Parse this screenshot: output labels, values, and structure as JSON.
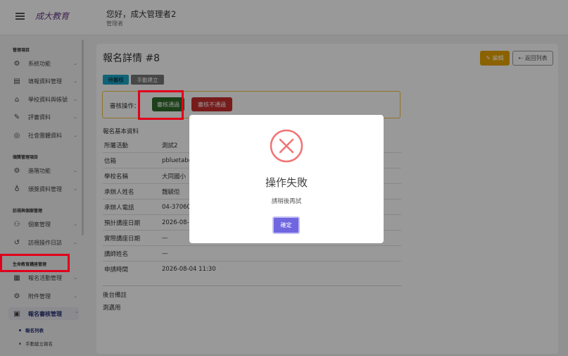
{
  "header": {
    "logo_text": "成大教育",
    "greeting": "您好，成大管理者2",
    "role": "管理者"
  },
  "sidebar": {
    "sections": [
      {
        "title": "管理項目",
        "items": [
          {
            "label": "系統功能",
            "icon": "gear-icon"
          },
          {
            "label": "填報資料管理",
            "icon": "form-icon"
          },
          {
            "label": "學校資料與帳號",
            "icon": "school-icon"
          },
          {
            "label": "評審資料",
            "icon": "review-icon"
          },
          {
            "label": "社會團體資料",
            "icon": "compass-icon"
          }
        ]
      },
      {
        "title": "頒獎管理項目",
        "items": [
          {
            "label": "進階功能",
            "icon": "gear-icon"
          },
          {
            "label": "頒獎資料管理",
            "icon": "medal-icon"
          }
        ]
      },
      {
        "title": "訪視與個案管理",
        "items": [
          {
            "label": "個案管理",
            "icon": "users-icon"
          },
          {
            "label": "訪視操作日誌",
            "icon": "history-icon"
          }
        ]
      },
      {
        "title": "生命教育講座管理",
        "items": [
          {
            "label": "報名活動管理",
            "icon": "calendar-icon"
          },
          {
            "label": "附件管理",
            "icon": "gear-icon"
          },
          {
            "label": "報名審核管理",
            "icon": "clipboard-icon"
          }
        ]
      }
    ],
    "sub_items": [
      "報名列表",
      "手動建立報名"
    ]
  },
  "main": {
    "title": "報名詳情 #8",
    "edit_label": "編輯",
    "back_label": "返回列表",
    "status_badge": "待審核",
    "source_badge": "手動建立",
    "review_label": "審核操作：",
    "approve_label": "審核通過",
    "reject_label": "審核不通過",
    "info_title": "報名基本資料",
    "info_rows": [
      {
        "k": "所屬活動",
        "v": "測試2"
      },
      {
        "k": "信箱",
        "v": "pbluetabo"
      },
      {
        "k": "學校名稱",
        "v": "大同國小"
      },
      {
        "k": "承辦人姓名",
        "v": "魏毓佢"
      },
      {
        "k": "承辦人電話",
        "v": "04-37060"
      },
      {
        "k": "預計講座日期",
        "v": "2026-08-"
      },
      {
        "k": "實際講座日期",
        "v": "—"
      },
      {
        "k": "講師姓名",
        "v": "—"
      },
      {
        "k": "申請時間",
        "v": "2026-08-04 11:30"
      }
    ],
    "note_title": "後台備註",
    "note_text": "測邁用"
  },
  "modal": {
    "title": "操作失敗",
    "message": "請稍後再試",
    "ok_label": "確定"
  },
  "colors": {
    "approve": "#2f6b2a",
    "reject": "#c62d2d",
    "edit": "#e8a400",
    "status": "#1aa7c9",
    "modal_button": "#7066e0",
    "error_icon": "#f27474",
    "highlight": "#e0001b"
  }
}
